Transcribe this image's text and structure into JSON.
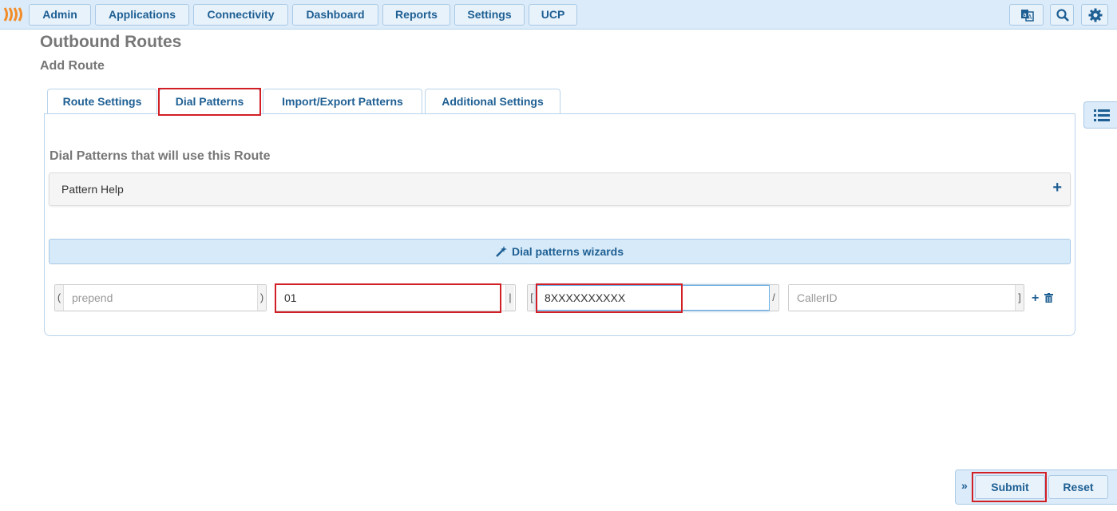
{
  "colors": {
    "accent": "#1e5f93",
    "bar_bg": "#dbebf9",
    "highlight_red": "#d21f26",
    "logo_orange": "#f28c28"
  },
  "nav": {
    "items": [
      "Admin",
      "Applications",
      "Connectivity",
      "Dashboard",
      "Reports",
      "Settings",
      "UCP"
    ],
    "right_icons": [
      "translate-icon",
      "search-icon",
      "gear-icon"
    ]
  },
  "page": {
    "title": "Outbound Routes",
    "subtitle": "Add Route"
  },
  "tabs": [
    "Route Settings",
    "Dial Patterns",
    "Import/Export Patterns",
    "Additional Settings"
  ],
  "active_tab": "Dial Patterns",
  "dial_patterns": {
    "section_title": "Dial Patterns that will use this Route",
    "pattern_help_label": "Pattern Help",
    "wizard_label": "Dial patterns wizards",
    "row": {
      "prepend": {
        "open": "(",
        "close": ")",
        "placeholder": "prepend",
        "value": ""
      },
      "prefix": {
        "value": "01",
        "separator": "|"
      },
      "match_pattern": {
        "open": "[",
        "value": "8XXXXXXXXXX",
        "separator": "/"
      },
      "callerid": {
        "placeholder": "CallerID",
        "close": "]",
        "value": ""
      }
    }
  },
  "actions": {
    "submit": "Submit",
    "reset": "Reset",
    "collapse": "»"
  }
}
